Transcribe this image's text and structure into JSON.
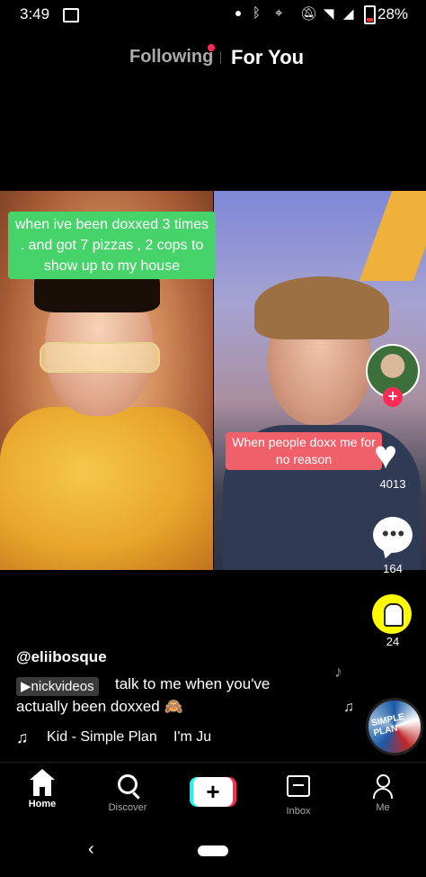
{
  "status_bar": {
    "time": "3:49",
    "battery": "28%",
    "icons": [
      "gallery-icon",
      "notification-dot-icon",
      "bluetooth-icon",
      "location-icon",
      "mute-icon",
      "wifi-icon",
      "signal-icon",
      "battery-icon"
    ],
    "battery_color": "#e53935"
  },
  "feed_tabs": {
    "following": "Following",
    "for_you": "For You",
    "notification_color": "#fe2c55"
  },
  "video": {
    "left_caption": "when ive been doxxed 3 times . and got 7 pizzas , 2 cops to show up to my house",
    "right_caption": "When people doxx me for no reason",
    "left_caption_color": "#46d369",
    "right_caption_color": "#f0606a"
  },
  "actions": {
    "likes": "4013",
    "comments": "164",
    "shares": "24"
  },
  "description": {
    "username": "@eliibosque",
    "duet_tag": "▶nickvideos",
    "text_line1": "talk to me when you've",
    "text_line2": "actually been doxxed 🙈",
    "song": "Kid - Simple Plan",
    "song_scroll": "I'm Ju"
  },
  "nav": {
    "items": [
      {
        "label": "Home",
        "icon": "home-icon"
      },
      {
        "label": "Discover",
        "icon": "search-icon"
      },
      {
        "label": "",
        "icon": "create-plus-icon"
      },
      {
        "label": "Inbox",
        "icon": "inbox-icon"
      },
      {
        "label": "Me",
        "icon": "profile-icon"
      }
    ]
  },
  "accent": {
    "tiktok_red": "#fe2c55",
    "tiktok_cyan": "#25f4ee",
    "snapchat_yellow": "#fffc00"
  }
}
